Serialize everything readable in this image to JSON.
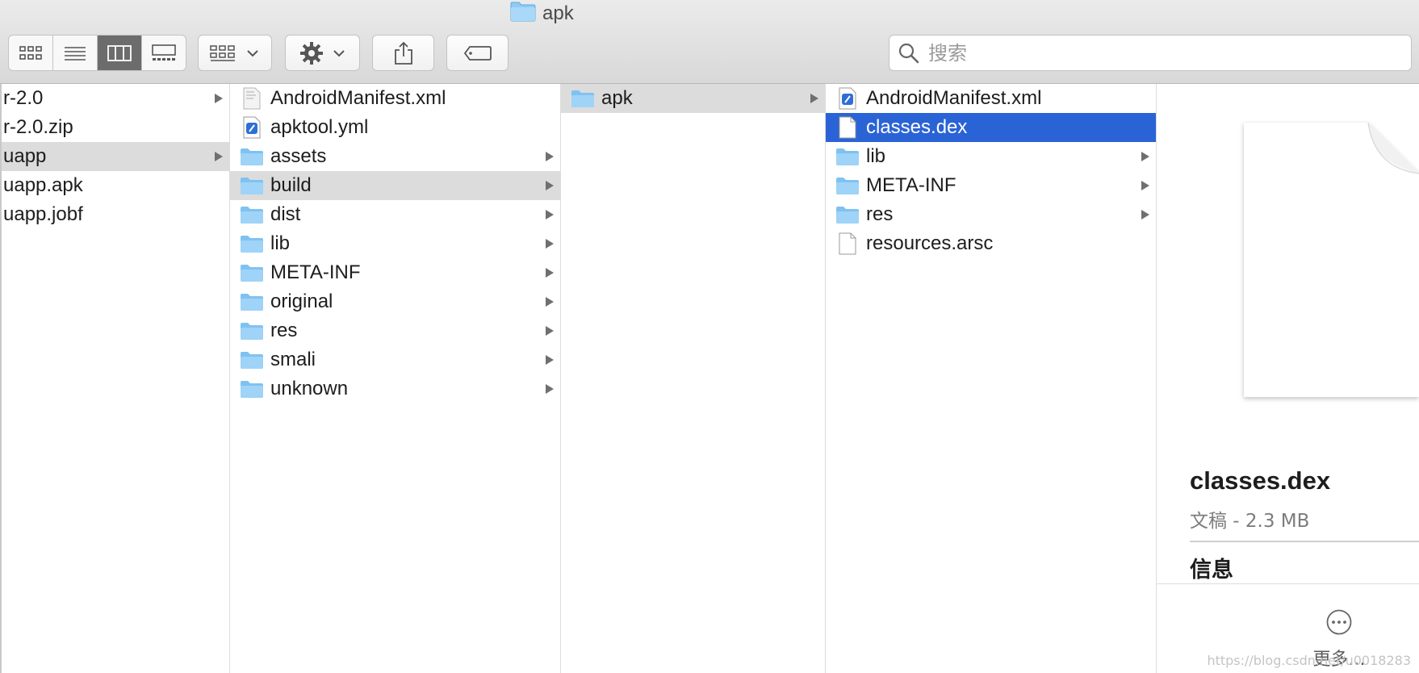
{
  "window": {
    "title": "apk"
  },
  "toolbar": {
    "view_buttons": [
      {
        "name": "icon-view",
        "active": false
      },
      {
        "name": "list-view",
        "active": false
      },
      {
        "name": "column-view",
        "active": true
      },
      {
        "name": "gallery-view",
        "active": false
      }
    ],
    "search_placeholder": "搜索"
  },
  "columns": [
    {
      "items": [
        {
          "name": "r-2.0",
          "type": "folder-partial",
          "has_children": true,
          "selected": false
        },
        {
          "name": "r-2.0.zip",
          "type": "file-partial",
          "has_children": false,
          "selected": false
        },
        {
          "name": "uapp",
          "type": "folder-partial",
          "has_children": true,
          "selected": "inactive"
        },
        {
          "name": "uapp.apk",
          "type": "file-partial",
          "has_children": false,
          "selected": false
        },
        {
          "name": "uapp.jobf",
          "type": "file-partial",
          "has_children": false,
          "selected": false
        }
      ]
    },
    {
      "items": [
        {
          "name": "AndroidManifest.xml",
          "type": "xml",
          "has_children": false,
          "selected": false
        },
        {
          "name": "apktool.yml",
          "type": "yml",
          "has_children": false,
          "selected": false
        },
        {
          "name": "assets",
          "type": "folder",
          "has_children": true,
          "selected": false
        },
        {
          "name": "build",
          "type": "folder",
          "has_children": true,
          "selected": "inactive"
        },
        {
          "name": "dist",
          "type": "folder",
          "has_children": true,
          "selected": false
        },
        {
          "name": "lib",
          "type": "folder",
          "has_children": true,
          "selected": false
        },
        {
          "name": "META-INF",
          "type": "folder",
          "has_children": true,
          "selected": false
        },
        {
          "name": "original",
          "type": "folder",
          "has_children": true,
          "selected": false
        },
        {
          "name": "res",
          "type": "folder",
          "has_children": true,
          "selected": false
        },
        {
          "name": "smali",
          "type": "folder",
          "has_children": true,
          "selected": false
        },
        {
          "name": "unknown",
          "type": "folder",
          "has_children": true,
          "selected": false
        }
      ]
    },
    {
      "items": [
        {
          "name": "apk",
          "type": "folder",
          "has_children": true,
          "selected": "inactive"
        }
      ]
    },
    {
      "items": [
        {
          "name": "AndroidManifest.xml",
          "type": "yml",
          "has_children": false,
          "selected": false
        },
        {
          "name": "classes.dex",
          "type": "doc",
          "has_children": false,
          "selected": "active"
        },
        {
          "name": "lib",
          "type": "folder",
          "has_children": true,
          "selected": false
        },
        {
          "name": "META-INF",
          "type": "folder",
          "has_children": true,
          "selected": false
        },
        {
          "name": "res",
          "type": "folder",
          "has_children": true,
          "selected": false
        },
        {
          "name": "resources.arsc",
          "type": "doc",
          "has_children": false,
          "selected": false
        }
      ]
    }
  ],
  "preview": {
    "filename": "classes.dex",
    "subtitle": "文稿 - 2.3 MB",
    "info_heading": "信息",
    "more_label": "更多..."
  },
  "watermark": "https://blog.csdn.net/u0018283",
  "colors": {
    "selection_active": "#2a63d6",
    "selection_inactive": "#dcdcdc",
    "folder_blue": "#7fc2f2"
  }
}
